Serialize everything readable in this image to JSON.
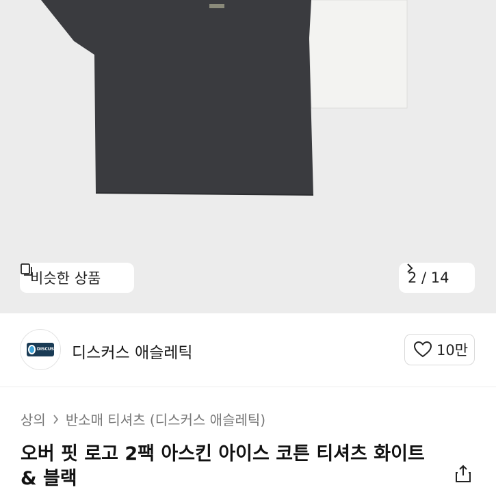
{
  "hero": {
    "similar_label": "비슷한 상품",
    "counter": "2 / 14"
  },
  "brand": {
    "name": "디스커스 애슬레틱",
    "logo_text": "DISCUS",
    "likes": "10만"
  },
  "product": {
    "breadcrumb": [
      "상의",
      "반소매 티셔츠 (디스커스 애슬레틱)"
    ],
    "title": "오버 핏 로고 2팩 아스킨 아이스 코튼 티셔츠 화이트 & 블랙"
  },
  "icons": {
    "similar": "similar-items-icon",
    "next": "chevron-right-icon",
    "like": "heart-icon",
    "share": "share-icon"
  }
}
